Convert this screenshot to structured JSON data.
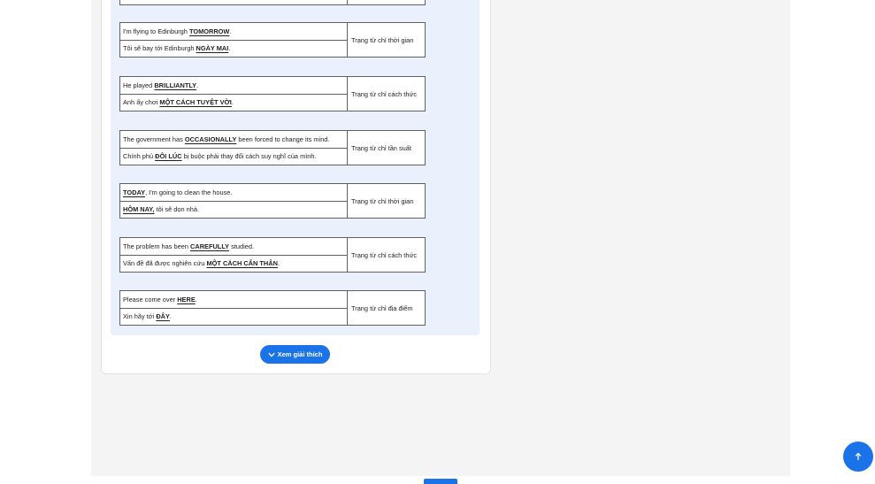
{
  "rows": [
    {
      "en": {
        "before": "I'm flying to Edinburgh ",
        "key": "TOMORROW",
        "after": "."
      },
      "vi": {
        "before": "Tôi sẽ bay tới Edinburgh ",
        "key": "NGÀY MAI",
        "after": "."
      },
      "type": "Trạng từ chỉ thời gian"
    },
    {
      "en": {
        "before": "He played ",
        "key": "BRILLIANTLY",
        "after": "."
      },
      "vi": {
        "before": "Anh ấy chơi ",
        "key": "MỘT CÁCH TUYỆT VỜI",
        "after": "."
      },
      "type": "Trạng từ chỉ cách thức"
    },
    {
      "en": {
        "before": "The government has ",
        "key": "OCCASIONALLY",
        "after": " been forced to change its mind."
      },
      "vi": {
        "before": "Chính phủ ",
        "key": "ĐÔI LÚC",
        "after": " bị buộc phải thay đổi cách suy nghĩ của mình."
      },
      "type": "Trạng từ chỉ tần suất"
    },
    {
      "en": {
        "before": "",
        "key": "TODAY",
        "after": ", I'm going to clean the house."
      },
      "vi": {
        "before": "",
        "key": "HÔM NAY,",
        "after": " tôi sẽ dọn nhà."
      },
      "type": "Trạng từ chỉ thời gian"
    },
    {
      "en": {
        "before": "The problem has been ",
        "key": "CAREFULLY",
        "after": " studied."
      },
      "vi": {
        "before": "Vấn đề đã được nghiên cứu ",
        "key": "MỘT CÁCH CẨN THẬN",
        "after": "."
      },
      "type": "Trạng từ chỉ cách thức"
    },
    {
      "en": {
        "before": "Please come over ",
        "key": "HERE",
        "after": "."
      },
      "vi": {
        "before": "Xin hãy tới ",
        "key": "ĐÂY",
        "after": "."
      },
      "type": "Trạng từ chỉ địa điểm"
    }
  ],
  "explain_button": {
    "label": "Xem giải thích",
    "icon": "chevron-down-icon"
  },
  "scroll_top": {
    "icon": "arrow-up-icon"
  },
  "colors": {
    "accent": "#1a73e8",
    "panel": "#eaf1fc"
  }
}
